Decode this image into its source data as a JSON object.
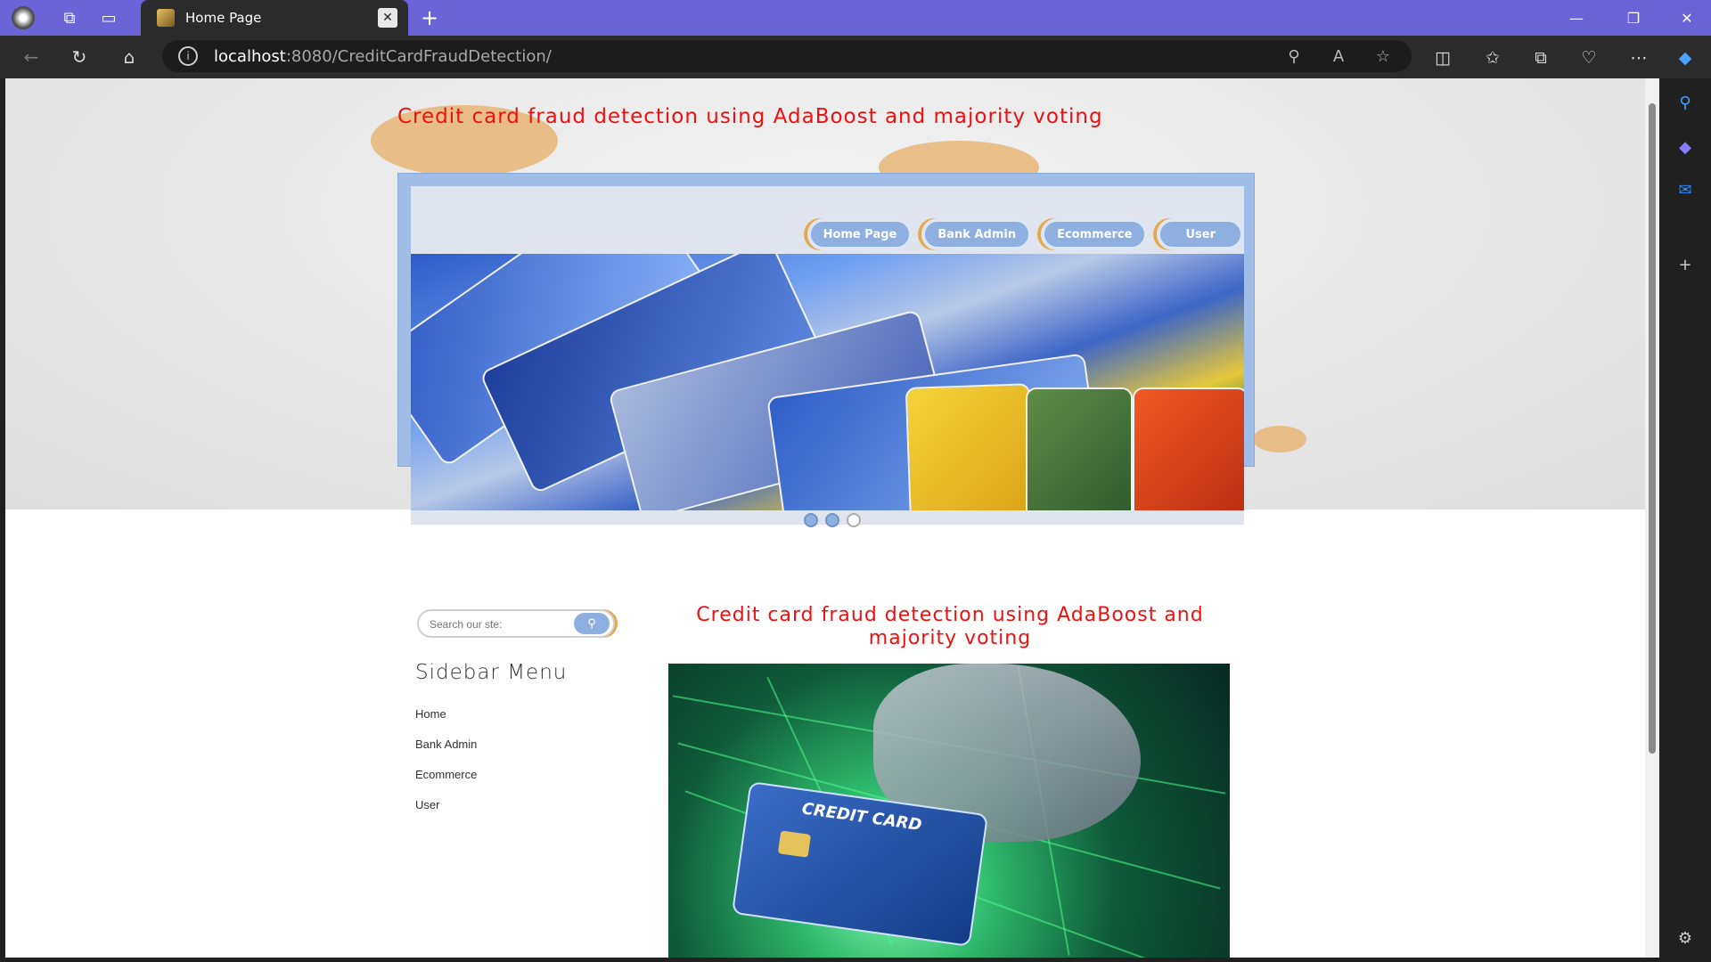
{
  "browser": {
    "tab_title": "Home Page",
    "url_host": "localhost",
    "url_rest": ":8080/CreditCardFraudDetection/"
  },
  "page": {
    "site_title": "Credit card fraud detection using AdaBoost and majority voting",
    "nav": [
      "Home Page",
      "Bank Admin",
      "Ecommerce",
      "User"
    ],
    "slider_dots": 3,
    "search_placeholder": "Search our ste:",
    "sidebar_title": "Sidebar Menu",
    "sidebar_items": [
      "Home",
      "Bank Admin",
      "Ecommerce",
      "User"
    ],
    "main_title": "Credit card fraud detection using AdaBoost and majority voting",
    "card_text": "CREDIT CARD"
  },
  "colors": {
    "title_red": "#e11111",
    "nav_blue": "#8db0e0",
    "accent_orange": "#e5a94e"
  }
}
